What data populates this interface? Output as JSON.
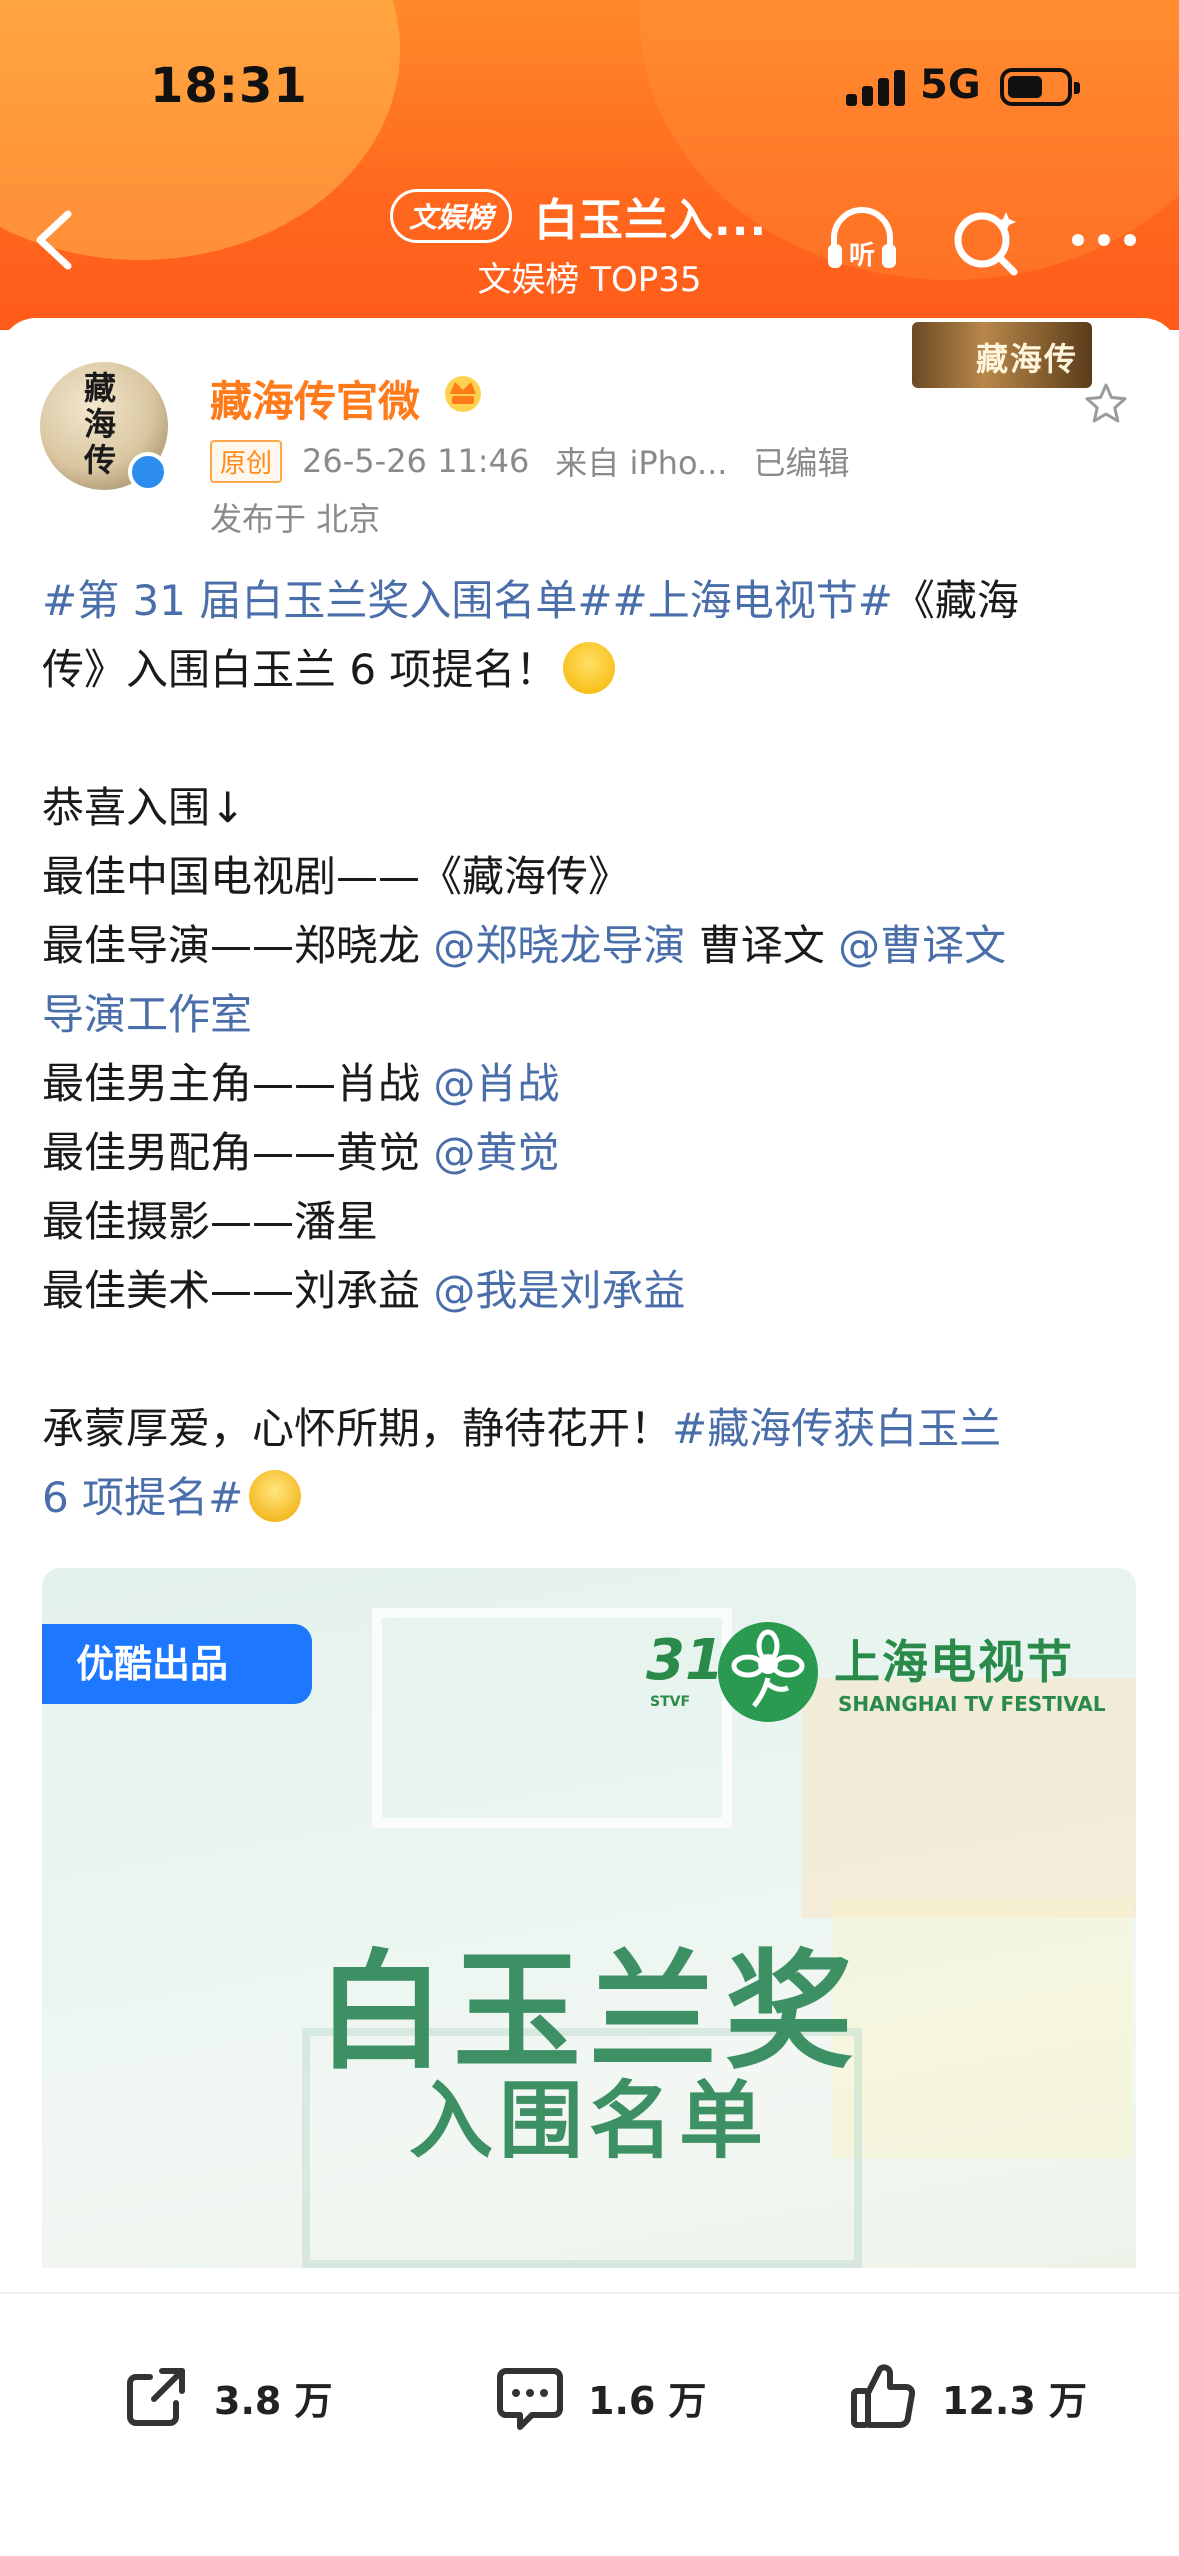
{
  "status_bar": {
    "time": "18:31",
    "network": "5G"
  },
  "header": {
    "tag": "文娱榜",
    "title": "白玉兰入...",
    "subtitle": "文娱榜 TOP35",
    "listen_label": "听"
  },
  "author": {
    "name": "藏海传官微",
    "avatar_text": "藏海传",
    "badge": "原创",
    "time": "26-5-26 11:46",
    "source": "来自 iPho...",
    "edited": "已编辑",
    "location": "发布于 北京",
    "brand_logo_text": "藏海传"
  },
  "post": {
    "line1": {
      "tag1": "#第 31 届白玉兰奖入围名单#",
      "tag2": "#上海电视节#",
      "text": "《藏海"
    },
    "line2": "传》入围白玉兰 6 项提名！",
    "line3": "恭喜入围↓",
    "line4": "最佳中国电视剧——《藏海传》",
    "line5": {
      "text1": "最佳导演——郑晓龙 ",
      "mention1": "@郑晓龙导演",
      "text2": " 曹译文 ",
      "mention2": "@曹译文"
    },
    "line6": "导演工作室",
    "line7": {
      "text": "最佳男主角——肖战 ",
      "mention": "@肖战"
    },
    "line8": {
      "text": "最佳男配角——黄觉 ",
      "mention": "@黄觉"
    },
    "line9": "最佳摄影——潘星",
    "line10": {
      "text": "最佳美术——刘承益 ",
      "mention": "@我是刘承益"
    },
    "line11": {
      "text": "承蒙厚爱，心怀所期，静待花开！",
      "tag": "#藏海传获白玉兰"
    },
    "line12": "6 项提名#"
  },
  "media": {
    "badge": "优酷出品",
    "festival_number": "31",
    "festival_abbr": "STVF",
    "festival_cn": "上海电视节",
    "festival_en": "SHANGHAI TV FESTIVAL",
    "title": "白玉兰奖",
    "subtitle": "入围名单"
  },
  "actions": {
    "share": "3.8 万",
    "comment": "1.6 万",
    "like": "12.3 万"
  },
  "colors": {
    "header_orange": "#ff6a1e",
    "username": "#ff7a1a",
    "link": "#4a6ea9",
    "festival_green": "#3d8f64"
  }
}
